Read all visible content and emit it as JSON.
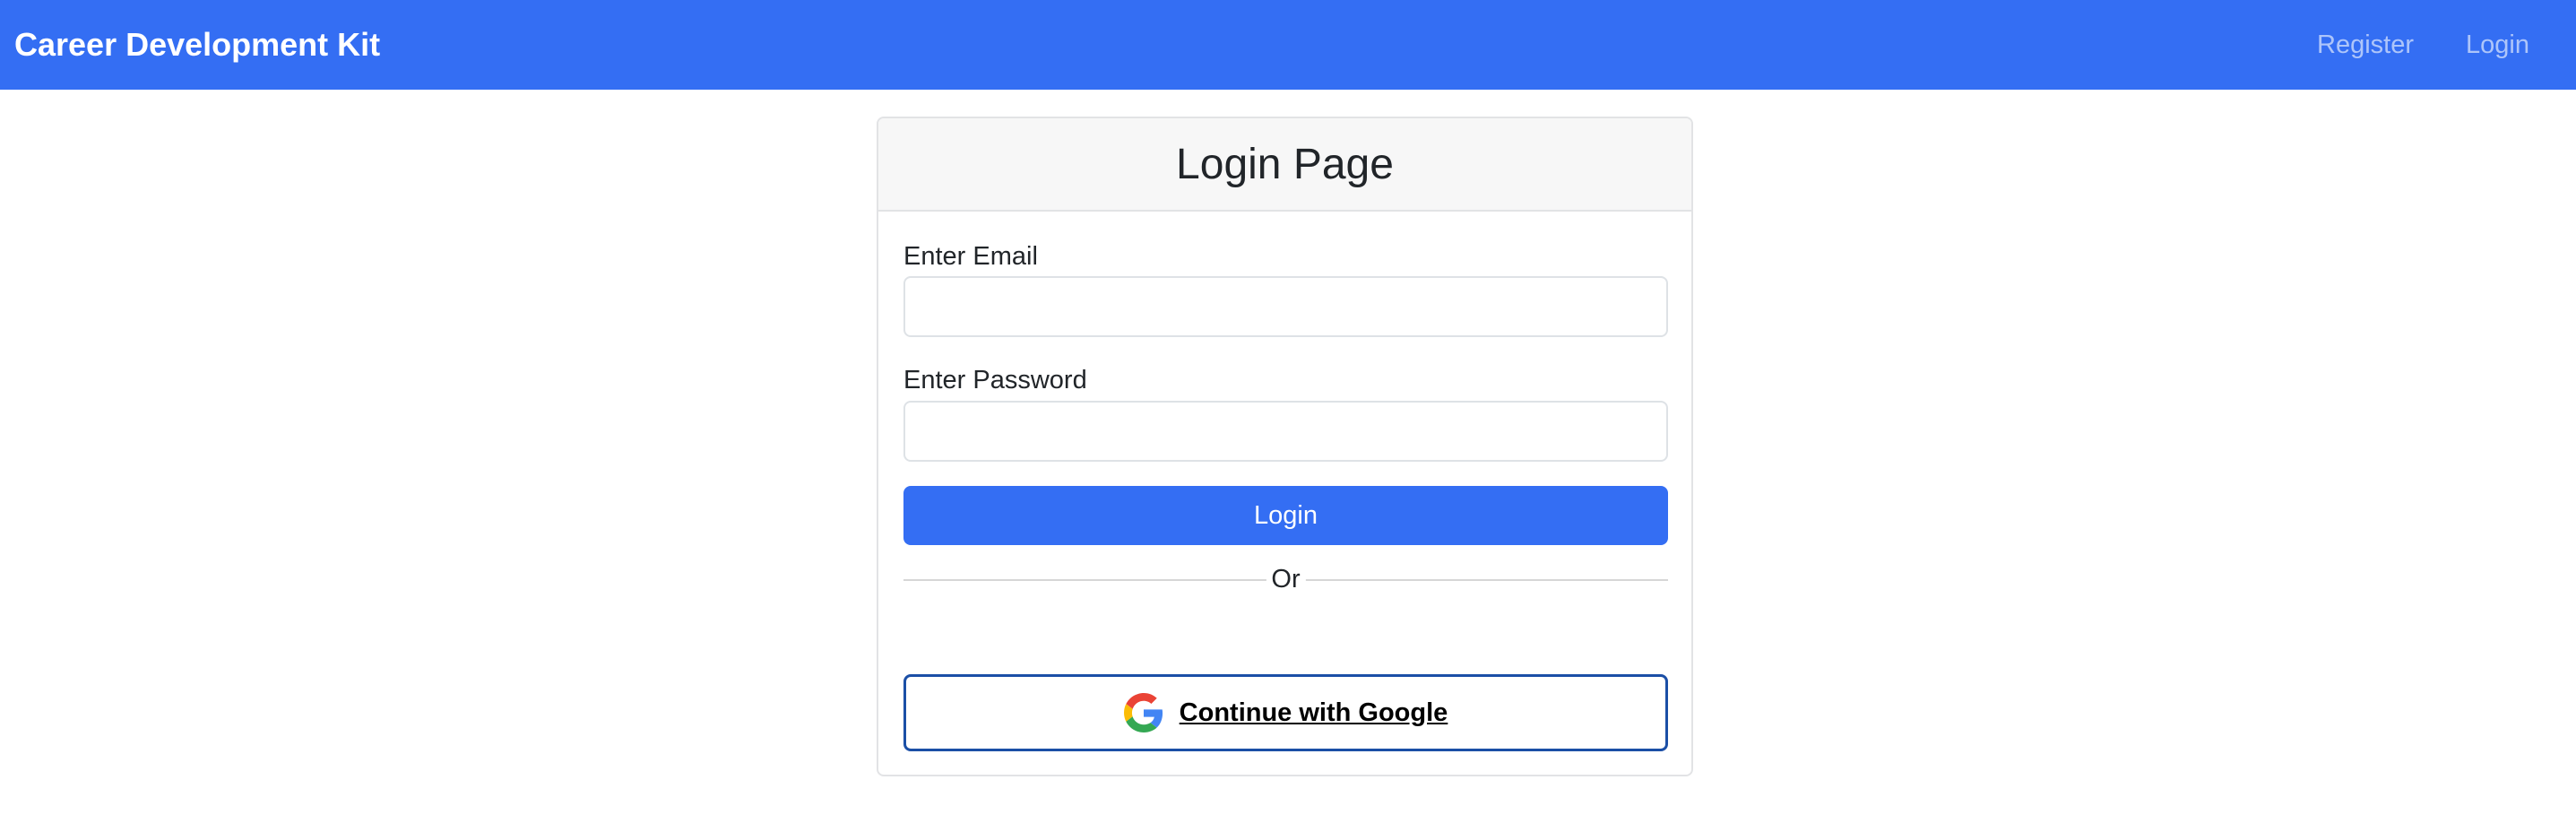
{
  "navbar": {
    "brand": "Career Development Kit",
    "links": [
      "Register",
      "Login"
    ]
  },
  "card": {
    "title": "Login Page",
    "email_label": "Enter Email",
    "email_value": "",
    "password_label": "Enter Password",
    "password_value": "",
    "login_button": "Login",
    "divider_text": "Or",
    "google_button": "Continue with Google"
  },
  "colors": {
    "primary": "#346ef3",
    "google_border": "#1b4fa6",
    "header_bg": "#f7f7f7"
  }
}
